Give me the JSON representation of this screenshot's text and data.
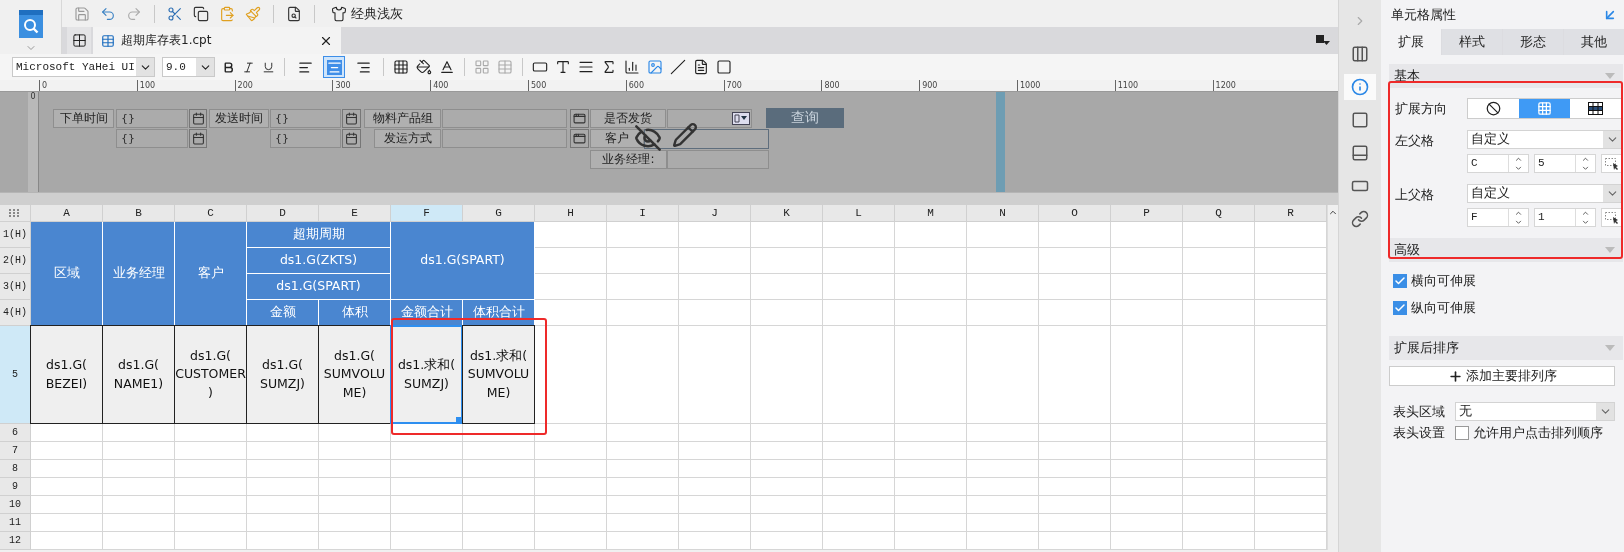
{
  "toolbar": {
    "theme_label": "经典浅灰"
  },
  "file_tab": {
    "title": "超期库存表1.cpt",
    "selected": true
  },
  "format_bar": {
    "font": "Microsoft YaHei UI",
    "size": "9.0",
    "alignment": [
      {
        "selected": false
      },
      {
        "selected": true
      },
      {
        "selected": false
      }
    ]
  },
  "ruler": {
    "ticks": [
      "0",
      "100",
      "200",
      "300",
      "400",
      "500",
      "600",
      "700",
      "800",
      "900",
      "1000",
      "1100",
      "1200"
    ],
    "vertical_ticks": [
      "0"
    ]
  },
  "parameter_panel": {
    "widgets": [
      {
        "kind": "label",
        "text": "下单时间"
      },
      {
        "kind": "field",
        "value": "{}"
      },
      {
        "kind": "calendar"
      },
      {
        "kind": "label",
        "text": "发送时间"
      },
      {
        "kind": "field",
        "value": "{}"
      },
      {
        "kind": "calendar"
      },
      {
        "kind": "label",
        "text": "物料产品组"
      },
      {
        "kind": "field"
      },
      {
        "kind": "picker"
      },
      {
        "kind": "label",
        "text": "是否发货"
      },
      {
        "kind": "combo"
      },
      {
        "kind": "button",
        "text": "查询"
      },
      {
        "kind": "field",
        "value": "{}"
      },
      {
        "kind": "calendar"
      },
      {
        "kind": "field",
        "value": "{}"
      },
      {
        "kind": "calendar"
      },
      {
        "kind": "label",
        "text": "发运方式"
      },
      {
        "kind": "field"
      },
      {
        "kind": "picker"
      },
      {
        "kind": "label",
        "text": "客户"
      },
      {
        "kind": "field"
      },
      {
        "kind": "label",
        "text": "业务经理:"
      },
      {
        "kind": "field"
      }
    ]
  },
  "sheet": {
    "columns": [
      {
        "label": "A",
        "selected": false
      },
      {
        "label": "B",
        "selected": false
      },
      {
        "label": "C",
        "selected": false
      },
      {
        "label": "D",
        "selected": false
      },
      {
        "label": "E",
        "selected": false
      },
      {
        "label": "F",
        "selected": true
      },
      {
        "label": "G",
        "selected": false
      },
      {
        "label": "H",
        "selected": false
      },
      {
        "label": "I",
        "selected": false
      },
      {
        "label": "J",
        "selected": false
      },
      {
        "label": "K",
        "selected": false
      },
      {
        "label": "L",
        "selected": false
      },
      {
        "label": "M",
        "selected": false
      },
      {
        "label": "N",
        "selected": false
      },
      {
        "label": "O",
        "selected": false
      },
      {
        "label": "P",
        "selected": false
      },
      {
        "label": "Q",
        "selected": false
      },
      {
        "label": "R",
        "selected": false
      }
    ],
    "rows": [
      {
        "label": "1(H)",
        "selected": false
      },
      {
        "label": "2(H)",
        "selected": false
      },
      {
        "label": "3(H)",
        "selected": false
      },
      {
        "label": "4(H)",
        "selected": false
      },
      {
        "label": "5",
        "selected": true
      },
      {
        "label": "6",
        "selected": false
      },
      {
        "label": "7",
        "selected": false
      },
      {
        "label": "8",
        "selected": false
      },
      {
        "label": "9",
        "selected": false
      },
      {
        "label": "10",
        "selected": false
      },
      {
        "label": "11",
        "selected": false
      },
      {
        "label": "12",
        "selected": false
      }
    ],
    "cells": [
      {
        "kind": "header",
        "text": "区域",
        "selected": false
      },
      {
        "kind": "header",
        "text": "业务经理",
        "selected": false
      },
      {
        "kind": "header",
        "text": "客户",
        "selected": false
      },
      {
        "kind": "header",
        "text": "超期周期",
        "selected": false
      },
      {
        "kind": "header",
        "text": "ds1.G(SPART)",
        "selected": false
      },
      {
        "kind": "header",
        "text": "ds1.G(ZKTS)",
        "selected": false
      },
      {
        "kind": "header",
        "text": "ds1.G(SPART)",
        "selected": false
      },
      {
        "kind": "header",
        "text": "金额",
        "selected": false
      },
      {
        "kind": "header",
        "text": "体积",
        "selected": false
      },
      {
        "kind": "header",
        "text": "金额合计",
        "selected": false
      },
      {
        "kind": "header",
        "text": "体积合计",
        "selected": false
      },
      {
        "kind": "data",
        "text": "ds1.G(\nBEZEI)",
        "selected": false
      },
      {
        "kind": "data",
        "text": "ds1.G(\nNAME1)",
        "selected": false
      },
      {
        "kind": "data",
        "text": "ds1.G(\nCUSTOMER\n)",
        "selected": false
      },
      {
        "kind": "data",
        "text": "ds1.G(\nSUMZJ)",
        "selected": false
      },
      {
        "kind": "data",
        "text": "ds1.G(\nSUMVOLU\nME)",
        "selected": false
      },
      {
        "kind": "data",
        "text": "ds1.求和(\nSUMZJ)",
        "selected": true
      },
      {
        "kind": "data",
        "text": "ds1.求和(\nSUMVOLU\nME)",
        "selected": false
      }
    ]
  },
  "side_icons": [
    {
      "kind": "expand",
      "selected": false
    },
    {
      "kind": "grid",
      "selected": false
    },
    {
      "kind": "cell-info",
      "selected": true
    },
    {
      "kind": "frame",
      "selected": false
    },
    {
      "kind": "widget",
      "selected": false
    },
    {
      "kind": "condition",
      "selected": false
    },
    {
      "kind": "link",
      "selected": false
    }
  ],
  "properties": {
    "title": "单元格属性",
    "tabs": [
      {
        "label": "扩展",
        "selected": true
      },
      {
        "label": "样式",
        "selected": false
      },
      {
        "label": "形态",
        "selected": false
      },
      {
        "label": "其他",
        "selected": false
      }
    ],
    "basic": {
      "title": "基本",
      "direction_label": "扩展方向",
      "directions": [
        {
          "kind": "none",
          "selected": false
        },
        {
          "kind": "vertical",
          "selected": true
        },
        {
          "kind": "horizontal",
          "selected": false
        }
      ],
      "parents": [
        {
          "label": "左父格",
          "mode": "自定义",
          "column": "C",
          "row": "5"
        },
        {
          "label": "上父格",
          "mode": "自定义",
          "column": "F",
          "row": "1"
        }
      ]
    },
    "advanced": {
      "title": "高级",
      "options": [
        {
          "label": "横向可伸展",
          "checked": true
        },
        {
          "label": "纵向可伸展",
          "checked": true
        }
      ]
    },
    "sorting": {
      "title": "扩展后排序",
      "add_button": "添加主要排列序"
    },
    "header_area": {
      "label": "表头区域",
      "value": "无"
    },
    "header_settings": {
      "label": "表头设置",
      "option": {
        "label": "允许用户点击排列顺序",
        "checked": false
      }
    }
  }
}
